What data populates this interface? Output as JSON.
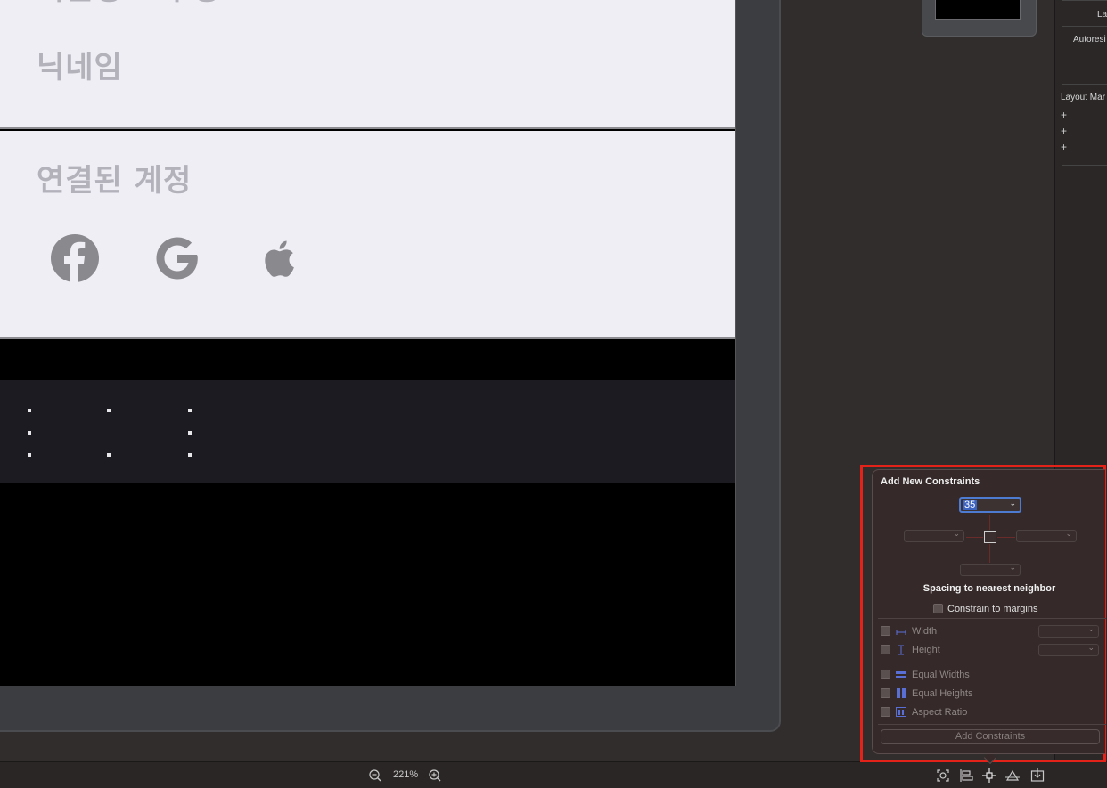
{
  "storyboard": {
    "cut_title": "회원정보 수정",
    "nickname_label": "닉네임",
    "accounts_title": "연결된 계정",
    "social_icons": [
      "facebook-icon",
      "google-icon",
      "apple-icon"
    ]
  },
  "inspector": {
    "row1": "La",
    "row2": "Autoresi",
    "section": "Layout Mar",
    "plus": [
      "+",
      "+",
      "+"
    ]
  },
  "bottombar": {
    "zoom": "221%",
    "tools": [
      "update-frames-icon",
      "align-icon",
      "add-constraints-icon",
      "resolve-issues-icon",
      "embed-in-icon"
    ]
  },
  "popover": {
    "title": "Add New Constraints",
    "top_value": "35",
    "left_value": "",
    "right_value": "",
    "bottom_value": "",
    "spacing_label": "Spacing to nearest neighbor",
    "constrain_margins": "Constrain to margins",
    "width_label": "Width",
    "height_label": "Height",
    "equal_widths": "Equal Widths",
    "equal_heights": "Equal Heights",
    "aspect_ratio": "Aspect Ratio",
    "add_button": "Add Constraints"
  },
  "colors": {
    "highlight": "#e3231a",
    "selection": "#4d7bd1",
    "constraint_icon": "#5a6fd6"
  }
}
